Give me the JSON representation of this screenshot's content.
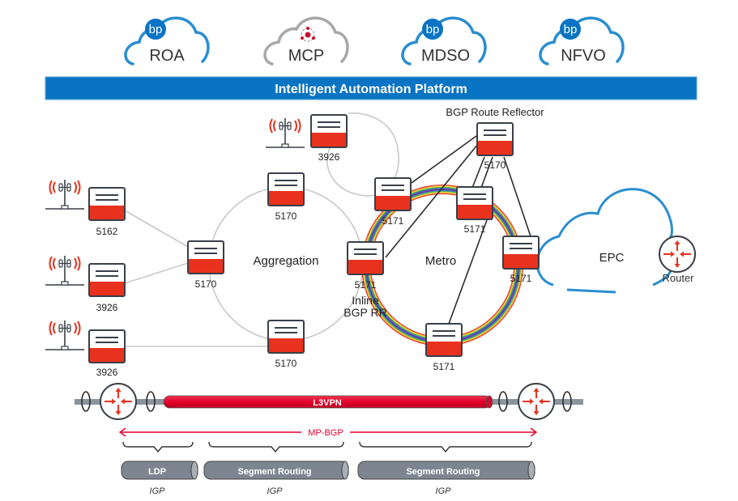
{
  "colors": {
    "brand_blue": "#0a74c4",
    "cloud_blue": "#2a8ed0",
    "cloud_grey": "#a8a8a8",
    "device_red": "#e8321e",
    "device_outline": "#3a3f48",
    "link_grey": "#c8c8c8",
    "link_dark": "#2c2c2c",
    "l3vpn_red": "#e4002b",
    "mpbgp_red": "#e4002b",
    "tunnel_grey": "#7d8690",
    "pipe_grey": "#8a959e",
    "text_dark": "#222222"
  },
  "clouds": [
    {
      "id": "roa",
      "label": "ROA",
      "badge": "bp",
      "style": "blue"
    },
    {
      "id": "mcp",
      "label": "MCP",
      "badge": "gear-cycle",
      "style": "grey"
    },
    {
      "id": "mdso",
      "label": "MDSO",
      "badge": "bp",
      "style": "blue"
    },
    {
      "id": "nfvo",
      "label": "NFVO",
      "badge": "bp",
      "style": "blue"
    }
  ],
  "platform_banner": "Intelligent Automation Platform",
  "rings": {
    "aggregation": "Aggregation",
    "metro": "Metro",
    "epc": "EPC"
  },
  "labels": {
    "bgp_rr": "BGP Route Reflector",
    "inline_rr_line1": "Inline",
    "inline_rr_line2": "BGP RR",
    "router": "Router"
  },
  "devices": {
    "cell_a": "5162",
    "cell_b": "3926",
    "cell_c": "3926",
    "cell_top": "3926",
    "agg_left": "5170",
    "agg_top": "5170",
    "agg_bottom": "5170",
    "metro_inline": "5171",
    "metro_topleft": "5171",
    "metro_top": "5171",
    "metro_right": "5171",
    "metro_bottom": "5171",
    "route_reflector": "5170"
  },
  "path": {
    "l3vpn": "L3VPN",
    "mpbgp": "MP-BGP",
    "segments": [
      {
        "label": "LDP",
        "sub": "IGP"
      },
      {
        "label": "Segment Routing",
        "sub": "IGP"
      },
      {
        "label": "Segment Routing",
        "sub": "IGP"
      }
    ]
  }
}
